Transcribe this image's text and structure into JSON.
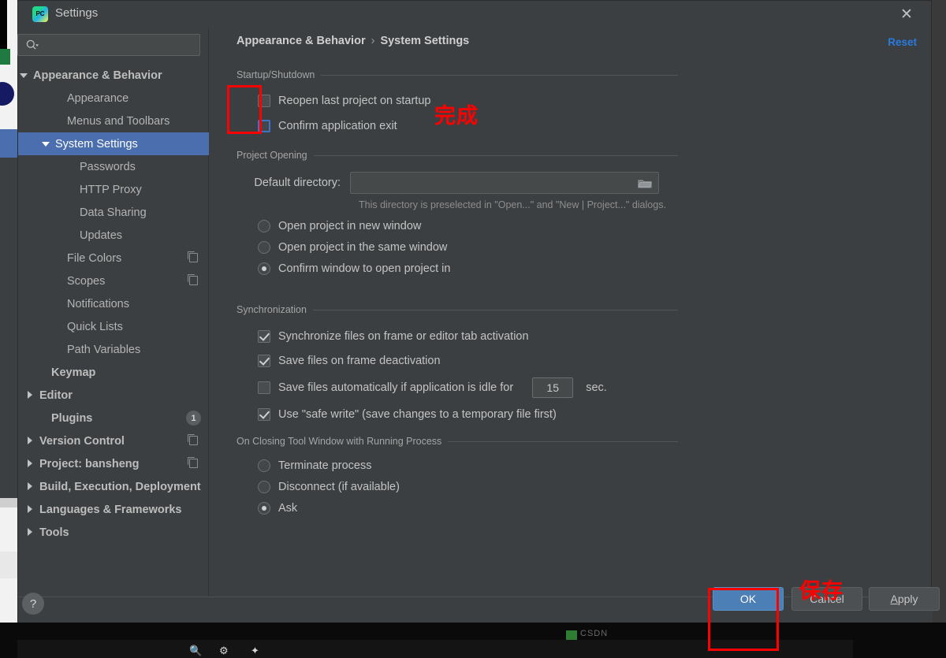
{
  "window": {
    "title": "Settings",
    "app_icon": "pycharm-icon",
    "close_icon": "close-icon"
  },
  "sidebar": {
    "search": {
      "placeholder": "",
      "value": "",
      "icon": "search-icon"
    },
    "items": [
      {
        "label": "Appearance & Behavior",
        "indent": 14,
        "arrow": "down",
        "bold": true,
        "selected": false,
        "badge": "",
        "copy": false
      },
      {
        "label": "Appearance",
        "indent": 62,
        "arrow": "none",
        "bold": false,
        "selected": false,
        "badge": "",
        "copy": false
      },
      {
        "label": "Menus and Toolbars",
        "indent": 62,
        "arrow": "none",
        "bold": false,
        "selected": false,
        "badge": "",
        "copy": false
      },
      {
        "label": "System Settings",
        "indent": 42,
        "arrow": "down",
        "bold": false,
        "selected": true,
        "badge": "",
        "copy": false
      },
      {
        "label": "Passwords",
        "indent": 78,
        "arrow": "none",
        "bold": false,
        "selected": false,
        "badge": "",
        "copy": false
      },
      {
        "label": "HTTP Proxy",
        "indent": 78,
        "arrow": "none",
        "bold": false,
        "selected": false,
        "badge": "",
        "copy": false
      },
      {
        "label": "Data Sharing",
        "indent": 78,
        "arrow": "none",
        "bold": false,
        "selected": false,
        "badge": "",
        "copy": false
      },
      {
        "label": "Updates",
        "indent": 78,
        "arrow": "none",
        "bold": false,
        "selected": false,
        "badge": "",
        "copy": false
      },
      {
        "label": "File Colors",
        "indent": 62,
        "arrow": "none",
        "bold": false,
        "selected": false,
        "badge": "",
        "copy": true
      },
      {
        "label": "Scopes",
        "indent": 62,
        "arrow": "none",
        "bold": false,
        "selected": false,
        "badge": "",
        "copy": true
      },
      {
        "label": "Notifications",
        "indent": 62,
        "arrow": "none",
        "bold": false,
        "selected": false,
        "badge": "",
        "copy": false
      },
      {
        "label": "Quick Lists",
        "indent": 62,
        "arrow": "none",
        "bold": false,
        "selected": false,
        "badge": "",
        "copy": false
      },
      {
        "label": "Path Variables",
        "indent": 62,
        "arrow": "none",
        "bold": false,
        "selected": false,
        "badge": "",
        "copy": false
      },
      {
        "label": "Keymap",
        "indent": 42,
        "arrow": "none",
        "bold": true,
        "selected": false,
        "badge": "",
        "copy": false
      },
      {
        "label": "Editor",
        "indent": 22,
        "arrow": "right",
        "bold": true,
        "selected": false,
        "badge": "",
        "copy": false
      },
      {
        "label": "Plugins",
        "indent": 42,
        "arrow": "none",
        "bold": true,
        "selected": false,
        "badge": "1",
        "copy": false
      },
      {
        "label": "Version Control",
        "indent": 22,
        "arrow": "right",
        "bold": true,
        "selected": false,
        "badge": "",
        "copy": true
      },
      {
        "label": "Project: bansheng",
        "indent": 22,
        "arrow": "right",
        "bold": true,
        "selected": false,
        "badge": "",
        "copy": true
      },
      {
        "label": "Build, Execution, Deployment",
        "indent": 22,
        "arrow": "right",
        "bold": true,
        "selected": false,
        "badge": "",
        "copy": false
      },
      {
        "label": "Languages & Frameworks",
        "indent": 22,
        "arrow": "right",
        "bold": true,
        "selected": false,
        "badge": "",
        "copy": false
      },
      {
        "label": "Tools",
        "indent": 22,
        "arrow": "right",
        "bold": true,
        "selected": false,
        "badge": "",
        "copy": false
      }
    ]
  },
  "main": {
    "breadcrumb": {
      "parent": "Appearance & Behavior",
      "separator": "›",
      "current": "System Settings"
    },
    "reset_label": "Reset",
    "startup": {
      "title": "Startup/Shutdown",
      "reopen_last_project": {
        "label": "Reopen last project on startup",
        "checked": false
      },
      "confirm_exit": {
        "label": "Confirm application exit",
        "checked": false,
        "focused": true
      }
    },
    "project_opening": {
      "title": "Project Opening",
      "default_directory_label": "Default directory:",
      "default_directory_value": "",
      "browse_icon": "folder-icon",
      "hint": "This directory is preselected in \"Open...\" and \"New | Project...\" dialogs.",
      "options": [
        {
          "label": "Open project in new window",
          "selected": false
        },
        {
          "label": "Open project in the same window",
          "selected": false
        },
        {
          "label": "Confirm window to open project in",
          "selected": true
        }
      ]
    },
    "synchronization": {
      "title": "Synchronization",
      "items": [
        {
          "label": "Synchronize files on frame or editor tab activation",
          "checked": true
        },
        {
          "label": "Save files on frame deactivation",
          "checked": true
        },
        {
          "label": "Save files automatically if application is idle for",
          "checked": false
        },
        {
          "label": "Use \"safe write\" (save changes to a temporary file first)",
          "checked": true
        }
      ],
      "idle_seconds_value": "15",
      "idle_seconds_unit": "sec."
    },
    "closing_tool_window": {
      "title": "On Closing Tool Window with Running Process",
      "options": [
        {
          "label": "Terminate process",
          "selected": false
        },
        {
          "label": "Disconnect (if available)",
          "selected": false
        },
        {
          "label": "Ask",
          "selected": true
        }
      ]
    }
  },
  "footer": {
    "help_label": "?",
    "ok_label": "OK",
    "cancel_label": "Cancel",
    "apply_label_pre": "A",
    "apply_label_post": "pply"
  },
  "annotations": [
    {
      "text": "完成",
      "meaning": "complete"
    },
    {
      "text": "保存",
      "meaning": "save"
    }
  ],
  "background": {
    "watermark": "CSDN"
  },
  "colors": {
    "panel": "#3c3f41",
    "selection": "#4b6eaf",
    "accent_link": "#287bde",
    "annotation": "#ff0000",
    "ok_button": "#4b7fb5"
  }
}
